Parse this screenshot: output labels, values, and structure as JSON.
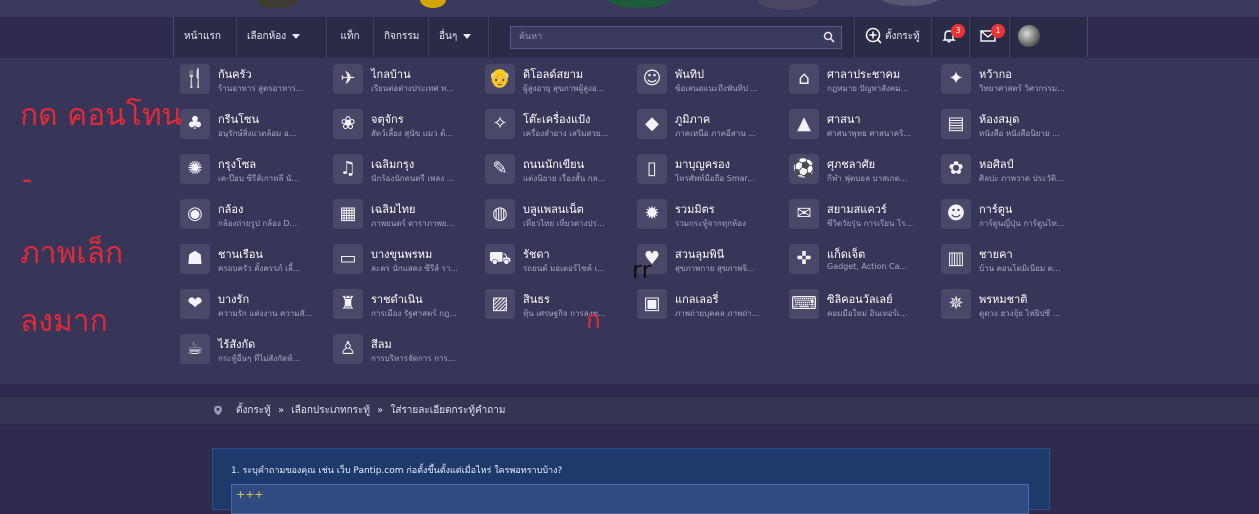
{
  "header": {
    "nav": {
      "home": "หน้าแรก",
      "choose_room": "เลือกห้อง",
      "tag": "แท็ก",
      "activity": "กิจกรรม",
      "more": "อื่นๆ"
    },
    "search": {
      "placeholder": "ค้นหา"
    },
    "create_topic": "ตั้งกระทู้",
    "notifications_count": "3",
    "messages_count": "1"
  },
  "categories": [
    {
      "name": "กันครัว",
      "desc": "ร้านอาหาร สูตรอาหาร...",
      "icon": "fork-knife-icon"
    },
    {
      "name": "ไกลบ้าน",
      "desc": "เรียนต่อต่างประเทศ ท...",
      "icon": "globe-plane-icon"
    },
    {
      "name": "ดิโอลด์สยาม",
      "desc": "ผู้สูงอายุ สุขภาพผู้สูงอ...",
      "icon": "elderly-icon"
    },
    {
      "name": "พันทิป",
      "desc": "ข้อเสนอแนะถึงพันทิป ...",
      "icon": "smiley-icon"
    },
    {
      "name": "ศาลาประชาคม",
      "desc": "กฎหมาย ปัญหาสังคม...",
      "icon": "pavilion-icon"
    },
    {
      "name": "หว้ากอ",
      "desc": "วิทยาศาสตร์ วิศวกรรม...",
      "icon": "telescope-icon"
    },
    {
      "name": "กรีนโซน",
      "desc": "อนุรักษ์สิ่งแวดล้อม อ...",
      "icon": "leaf-hand-icon"
    },
    {
      "name": "จตุจักร",
      "desc": "สัตว์เลี้ยง สุนัข แมว ต้...",
      "icon": "pets-icon"
    },
    {
      "name": "โต๊ะเครื่องแป้ง",
      "desc": "เครื่องสำอาง เสริมสวย...",
      "icon": "cosmetics-icon"
    },
    {
      "name": "ภูมิภาค",
      "desc": "ภาคเหนือ ภาคอีสาน ...",
      "icon": "thailand-map-icon"
    },
    {
      "name": "ศาสนา",
      "desc": "ศาสนาพุทธ ศาสนาคริ...",
      "icon": "temple-icon"
    },
    {
      "name": "ห้องสมุด",
      "desc": "หนังสือ หนังสือนิยาย ...",
      "icon": "book-icon"
    },
    {
      "name": "กรุงโซล",
      "desc": "เค-ป๊อบ ซีรีส์เกาหลี นั...",
      "icon": "korea-icon"
    },
    {
      "name": "เฉลิมกรุง",
      "desc": "นักร้องนักดนตรี เพลง ...",
      "icon": "music-note-icon"
    },
    {
      "name": "ถนนนักเขียน",
      "desc": "แต่งนิยาย เรื่องสั้น กล...",
      "icon": "pen-icon"
    },
    {
      "name": "มาบุญครอง",
      "desc": "โทรศัพท์มือถือ Smar...",
      "icon": "phone-icon"
    },
    {
      "name": "ศุภชลาศัย",
      "desc": "กีฬา ฟุตบอล บาสเกต...",
      "icon": "sports-icon"
    },
    {
      "name": "หอศิลป์",
      "desc": "ศิลปะ ภาพวาด ประวัติ...",
      "icon": "palette-icon"
    },
    {
      "name": "กล้อง",
      "desc": "กล้องถ่ายรูป กล้อง D...",
      "icon": "camera-icon"
    },
    {
      "name": "เฉลิมไทย",
      "desc": "ภาพยนตร์ ดาราภาพย...",
      "icon": "film-icon"
    },
    {
      "name": "บลูแพลนเน็ต",
      "desc": "เที่ยวไทย เที่ยวต่างปร...",
      "icon": "travel-globe-icon"
    },
    {
      "name": "รวมมิตร",
      "desc": "รวมกระทู้จากทุกห้อง",
      "icon": "starburst-icon"
    },
    {
      "name": "สยามสแควร์",
      "desc": "ชีวิตวัยรุ่น การเรียน โร...",
      "icon": "chat-bubbles-icon"
    },
    {
      "name": "การ์ตูน",
      "desc": "การ์ตูนญี่ปุ่น การ์ตูนไท...",
      "icon": "cartoon-icon"
    },
    {
      "name": "ชานเรือน",
      "desc": "ครอบครัว ตั้งครรภ์ เลี้...",
      "icon": "family-icon"
    },
    {
      "name": "บางขุนพรหม",
      "desc": "ละคร นักแสดง ซีรีส์ รา...",
      "icon": "tv-icon"
    },
    {
      "name": "รัชดา",
      "desc": "รถยนต์ มอเตอร์ไซค์ เ...",
      "icon": "car-icon"
    },
    {
      "name": "สวนลุมพินี",
      "desc": "สุขภาพกาย สุขภาพจิ...",
      "icon": "health-heart-icon"
    },
    {
      "name": "แก็ดเจ็ต",
      "desc": "Gadget, Action Ca...",
      "icon": "gamepad-icon"
    },
    {
      "name": "ชายคา",
      "desc": "บ้าน คอนโดมิเนียม ต...",
      "icon": "building-icon"
    },
    {
      "name": "บางรัก",
      "desc": "ความรัก แต่งงาน ความสั...",
      "icon": "hearts-icon"
    },
    {
      "name": "ราชดำเนิน",
      "desc": "การเมือง รัฐศาสตร์ กฎ...",
      "icon": "monument-icon"
    },
    {
      "name": "สินธร",
      "desc": "หุ้น เศรษฐกิจ การลงทุ...",
      "icon": "stock-chart-icon"
    },
    {
      "name": "แกลเลอรี่",
      "desc": "ภาพถ่ายบุคคล ภาพถ่า...",
      "icon": "gallery-icon"
    },
    {
      "name": "ซิลิคอนวัลเลย์",
      "desc": "คอมมือใหม่ อินเทอร์เ...",
      "icon": "computer-code-icon"
    },
    {
      "name": "พรหมชาติ",
      "desc": "ดูดวง ฮวงจุ้ย ไพ่ยิปซี ...",
      "icon": "zodiac-icon"
    },
    {
      "name": "ไร้สังกัด",
      "desc": "กระทู้อื่นๆ ที่ไม่สังกัดห้...",
      "icon": "coffee-cup-icon"
    },
    {
      "name": "สีลม",
      "desc": "การบริหารจัดการ การ...",
      "icon": "business-person-icon"
    }
  ],
  "overlay_text": {
    "line1": "กด   คอนโทน",
    "dash": "-",
    "line2": "ภาพเล็ก",
    "line3": "ลงมาก",
    "scribble_rr": "rr",
    "scribble_k": "ก"
  },
  "breadcrumb": {
    "step1": "ตั้งกระทู้",
    "sep": "»",
    "step2": "เลือกประเภทกระทู้",
    "step3": "ใส่รายละเอียดกระทู้คำถาม"
  },
  "form": {
    "question_label": "1. ระบุคำถามของคุณ เช่น เว็บ Pantip.com ก่อตั้งขึ้นตั้งแต่เมื่อไหร่ ใครพอทราบบ้าง?",
    "question_value": "+++"
  },
  "colors": {
    "page_bg": "#2f2b4f",
    "menu_bg": "#383658",
    "form_bg": "#1d3a6b",
    "badge": "#e33333",
    "annotation_red": "#e02a3a",
    "input_text": "#f0c840"
  }
}
